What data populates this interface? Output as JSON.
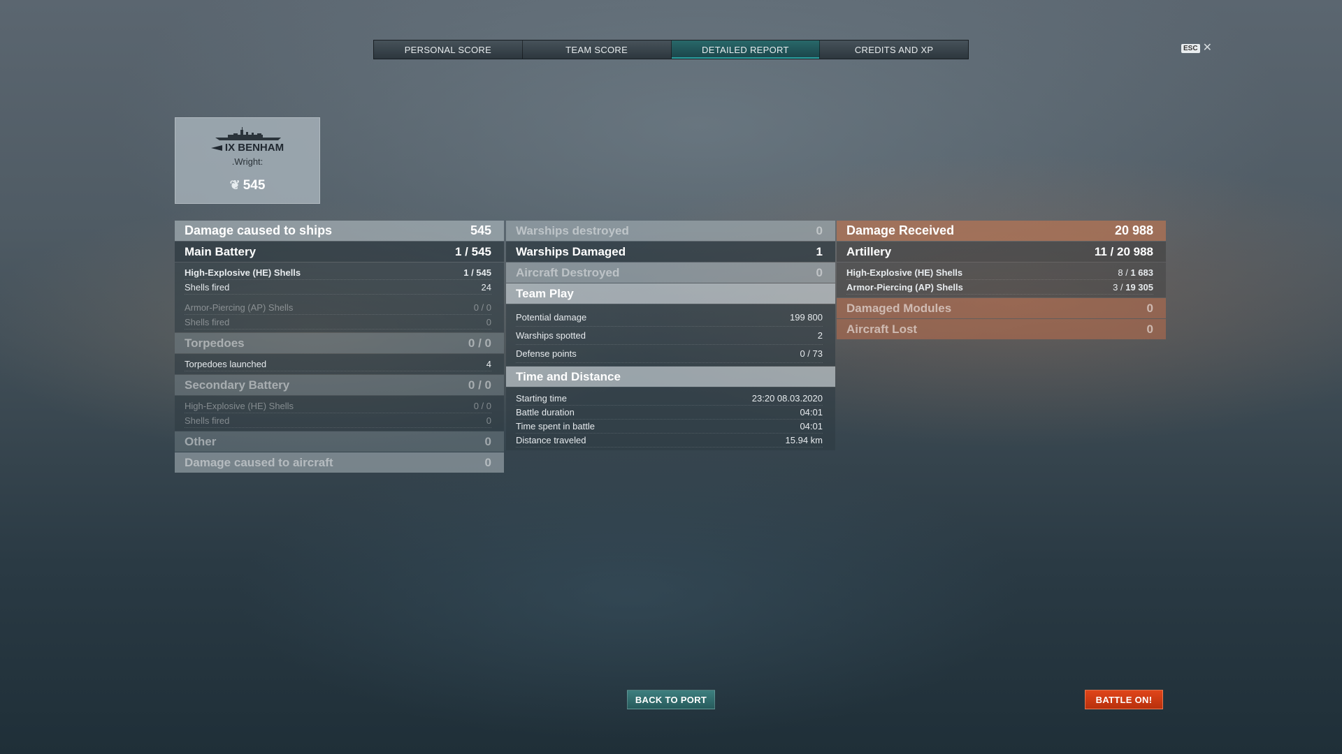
{
  "tabs": [
    {
      "label": "PERSONAL SCORE"
    },
    {
      "label": "TEAM SCORE"
    },
    {
      "label": "DETAILED REPORT"
    },
    {
      "label": "CREDITS AND XP"
    }
  ],
  "esc": {
    "key": "ESC",
    "close": "✕"
  },
  "ship": {
    "name": "IX BENHAM",
    "player": ".Wright:",
    "score": "545"
  },
  "left": {
    "damage_ships": {
      "label": "Damage caused to ships",
      "value": "545"
    },
    "main_battery": {
      "label": "Main Battery",
      "value": "1 / 545"
    },
    "he": {
      "label": "High-Explosive (HE) Shells",
      "value": "1 / 545"
    },
    "he_fired": {
      "label": "Shells fired",
      "value": "24"
    },
    "ap": {
      "label": "Armor-Piercing (AP) Shells",
      "value": "0 / 0"
    },
    "ap_fired": {
      "label": "Shells fired",
      "value": "0"
    },
    "torpedoes": {
      "label": "Torpedoes",
      "value": "0 / 0"
    },
    "torp_launched": {
      "label": "Torpedoes launched",
      "value": "4"
    },
    "secondary": {
      "label": "Secondary Battery",
      "value": "0 / 0"
    },
    "sec_he": {
      "label": "High-Explosive (HE) Shells",
      "value": "0 / 0"
    },
    "sec_fired": {
      "label": "Shells fired",
      "value": "0"
    },
    "other": {
      "label": "Other",
      "value": "0"
    },
    "damage_aircraft": {
      "label": "Damage caused to aircraft",
      "value": "0"
    }
  },
  "middle": {
    "warships_destroyed": {
      "label": "Warships destroyed",
      "value": "0"
    },
    "warships_damaged": {
      "label": "Warships Damaged",
      "value": "1"
    },
    "aircraft_destroyed": {
      "label": "Aircraft Destroyed",
      "value": "0"
    },
    "team_play": {
      "label": "Team Play"
    },
    "potential": {
      "label": "Potential damage",
      "value": "199 800"
    },
    "spotted": {
      "label": "Warships spotted",
      "value": "2"
    },
    "defense": {
      "label": "Defense points",
      "value": "0 / 73"
    },
    "time_dist": {
      "label": "Time and Distance"
    },
    "start": {
      "label": "Starting time",
      "value": "23:20  08.03.2020"
    },
    "duration": {
      "label": "Battle duration",
      "value": "04:01"
    },
    "time_spent": {
      "label": "Time spent in battle",
      "value": "04:01"
    },
    "distance": {
      "label": "Distance traveled",
      "value": "15.94 km"
    }
  },
  "right": {
    "damage_received": {
      "label": "Damage Received",
      "value": "20 988"
    },
    "artillery": {
      "label": "Artillery",
      "value": "11 / 20 988"
    },
    "he": {
      "label": "High-Explosive (HE) Shells",
      "value_a": "8 / ",
      "value_b": "1 683"
    },
    "ap": {
      "label": "Armor-Piercing (AP) Shells",
      "value_a": "3 / ",
      "value_b": "19 305"
    },
    "modules": {
      "label": "Damaged Modules",
      "value": "0"
    },
    "aircraft_lost": {
      "label": "Aircraft Lost",
      "value": "0"
    }
  },
  "buttons": {
    "back": "BACK TO PORT",
    "battle": "BATTLE ON!"
  },
  "colors": {
    "active_tab": "#1f6f72",
    "battle_button": "#d83a12",
    "port_button": "#2f6d6e",
    "received": "#c87850"
  }
}
